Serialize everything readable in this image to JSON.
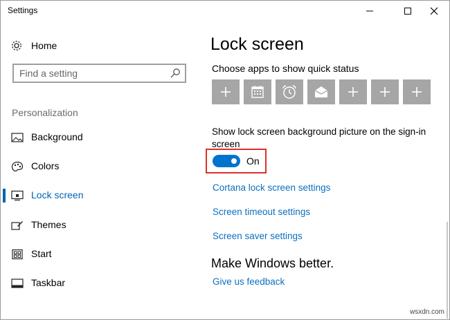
{
  "window": {
    "title": "Settings"
  },
  "sidebar": {
    "home_label": "Home",
    "search_placeholder": "Find a setting",
    "section_label": "Personalization",
    "items": [
      {
        "label": "Background",
        "icon": "image-icon"
      },
      {
        "label": "Colors",
        "icon": "palette-icon"
      },
      {
        "label": "Lock screen",
        "icon": "lock-screen-icon",
        "selected": true
      },
      {
        "label": "Themes",
        "icon": "themes-icon"
      },
      {
        "label": "Start",
        "icon": "start-icon"
      },
      {
        "label": "Taskbar",
        "icon": "taskbar-icon"
      }
    ]
  },
  "main": {
    "title": "Lock screen",
    "quick_status_label": "Choose apps to show quick status",
    "quick_status_apps": [
      "plus-icon",
      "calendar-icon",
      "alarm-clock-icon",
      "mail-icon",
      "plus-icon",
      "plus-icon",
      "plus-icon"
    ],
    "bg_toggle_label": "Show lock screen background picture on the sign-in screen",
    "bg_toggle_state": "On",
    "links": {
      "cortana": "Cortana lock screen settings",
      "timeout": "Screen timeout settings",
      "saver": "Screen saver settings"
    },
    "make_better_title": "Make Windows better.",
    "feedback_link": "Give us feedback"
  },
  "watermark": "wsxdn.com",
  "colors": {
    "accent": "#0063b1",
    "link": "#0b6fbf",
    "toggle_on": "#0073cf",
    "highlight_box": "#d9302b",
    "tile_bg": "#a6a6a6"
  }
}
